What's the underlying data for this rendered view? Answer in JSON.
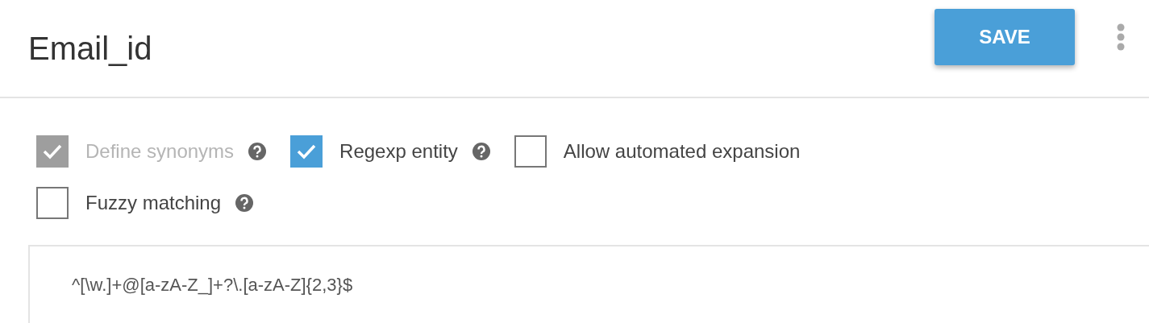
{
  "header": {
    "title": "Email_id",
    "save_button": "SAVE"
  },
  "options": [
    {
      "label": "Define synonyms",
      "checked": true,
      "disabled": true,
      "help": true
    },
    {
      "label": "Regexp entity",
      "checked": true,
      "disabled": false,
      "help": true
    },
    {
      "label": "Allow automated expansion",
      "checked": false,
      "disabled": false,
      "help": false
    },
    {
      "label": "Fuzzy matching",
      "checked": false,
      "disabled": false,
      "help": true
    }
  ],
  "entries": [
    {
      "value": "^[\\w.]+@[a-zA-Z_]+?\\.[a-zA-Z]{2,3}$"
    }
  ]
}
